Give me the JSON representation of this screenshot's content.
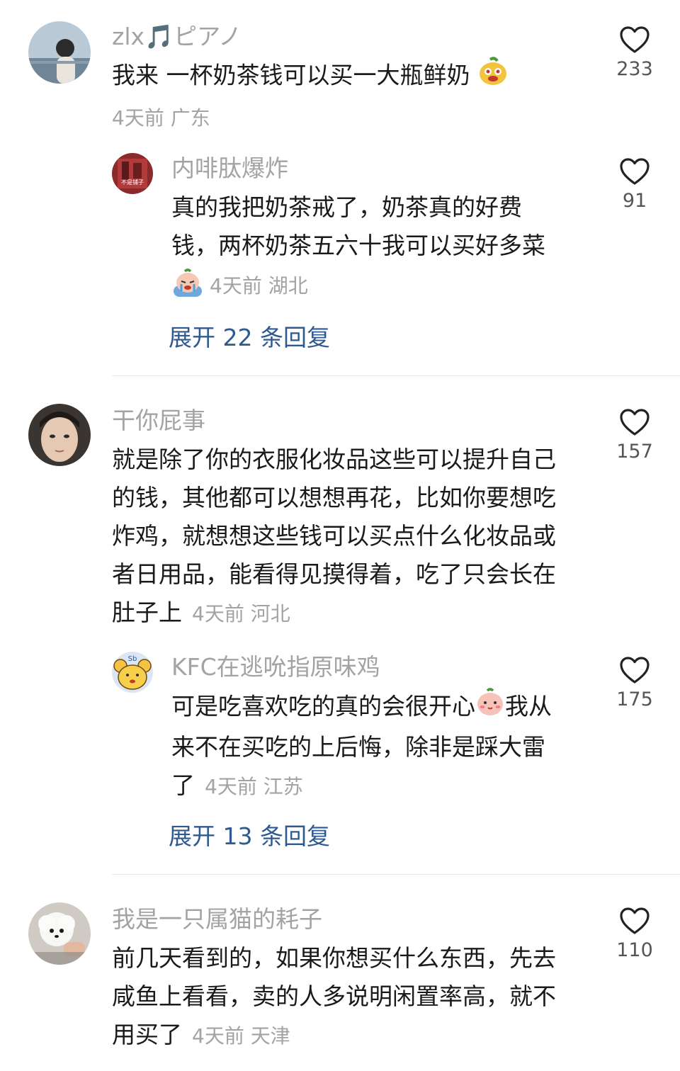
{
  "comments": [
    {
      "name": "zlx🎵ピアノ",
      "text_lines": [
        "我来 一杯奶茶钱可以买一大瓶鲜奶"
      ],
      "meta": "4天前 广东",
      "likes": "233"
    },
    {
      "name": "内啡肽爆炸",
      "avatar_caption": "不是铺子",
      "text_lines": [
        "真的我把奶茶戒了，奶茶真的好费",
        "钱，两杯奶茶五六十我可以买好多菜"
      ],
      "meta": "4天前 湖北",
      "likes": "91",
      "expand": "展开 22 条回复"
    },
    {
      "name": "干你屁事",
      "text_lines": [
        "就是除了你的衣服化妆品这些可以提升自己",
        "的钱，其他都可以想想再花，比如你要想吃",
        "炸鸡，就想想这些钱可以买点什么化妆品或",
        "者日用品，能看得见摸得着，吃了只会长在",
        "肚子上"
      ],
      "meta": "4天前 河北",
      "likes": "157"
    },
    {
      "name": "KFC在逃吮指原味鸡",
      "avatar_caption": "Sb",
      "text_lines": [
        "可是吃喜欢吃的真的会很开心",
        "我从",
        "来不在买吃的上后悔，除非是踩大雷",
        "了"
      ],
      "meta": "4天前 江苏",
      "likes": "175",
      "expand": "展开 13 条回复"
    },
    {
      "name": "我是一只属猫的耗子",
      "text_lines": [
        "前几天看到的，如果你想买什么东西，先去",
        "咸鱼上看看，卖的人多说明闲置率高，就不",
        "用买了"
      ],
      "meta": "4天前 天津",
      "likes": "110"
    }
  ],
  "colors": {
    "name": "#a3a3a3",
    "text": "#1a1a1a",
    "expand": "#2e5a8e",
    "like_count": "#555555"
  },
  "icons": {
    "like": "heart-outline-icon"
  }
}
